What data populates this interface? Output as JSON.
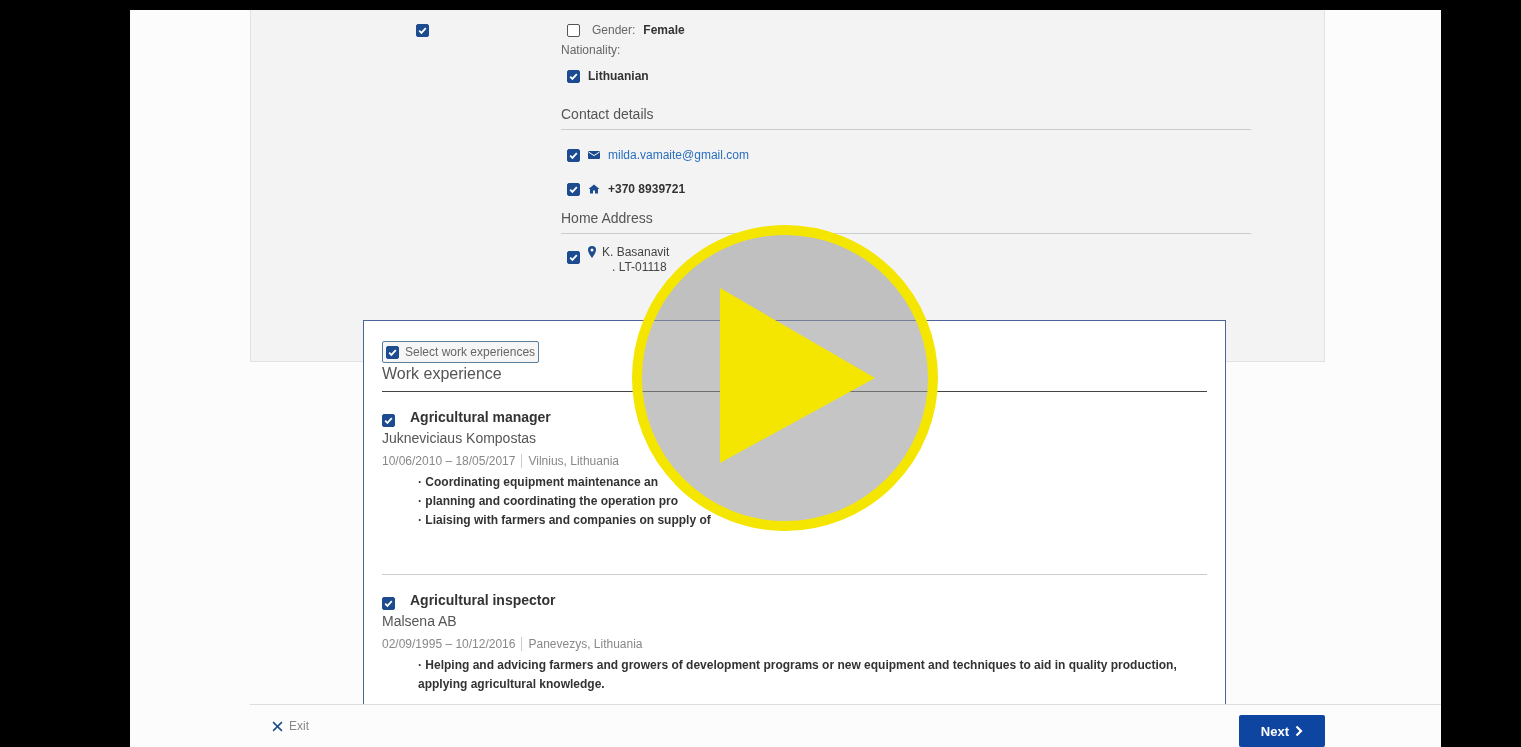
{
  "player": {
    "paused": true
  },
  "personal": {
    "section_checked": true,
    "gender": {
      "label": "Gender:",
      "value": "Female",
      "checked": false
    },
    "nationality_label": "Nationality:",
    "nationalities": [
      {
        "value": "Lithuanian",
        "checked": true
      }
    ],
    "contact_heading": "Contact details",
    "contacts": [
      {
        "kind": "email",
        "value": "milda.vamaite@gmail.com",
        "checked": true
      },
      {
        "kind": "phone",
        "value": "+370 8939721",
        "checked": true
      }
    ],
    "address_heading": "Home Address",
    "address": {
      "checked": true,
      "lines": [
        "K. Basanavit",
        ". LT-01118"
      ]
    }
  },
  "work": {
    "select": {
      "label": "Select work experiences",
      "checked": true
    },
    "heading": "Work experience",
    "items": [
      {
        "title": "Agricultural manager",
        "checked": true,
        "employer": "Jukneviciaus Kompostas",
        "dates": "10/06/2010 – 18/05/2017",
        "place": "Vilnius, Lithuania",
        "bullets": [
          "· Coordinating equipment maintenance an",
          "· planning and coordinating the operation pro",
          "· Liaising with farmers and companies on supply of"
        ]
      },
      {
        "title": "Agricultural inspector",
        "checked": true,
        "employer": "Malsena AB",
        "dates": "02/09/1995 – 10/12/2016",
        "place": "Panevezys, Lithuania",
        "bullets": [
          "· Helping and advicing farmers and growers of development programs or new equipment and techniques to aid in quality production, applying agricultural knowledge."
        ]
      }
    ]
  },
  "footer": {
    "exit": "Exit",
    "next": "Next"
  }
}
